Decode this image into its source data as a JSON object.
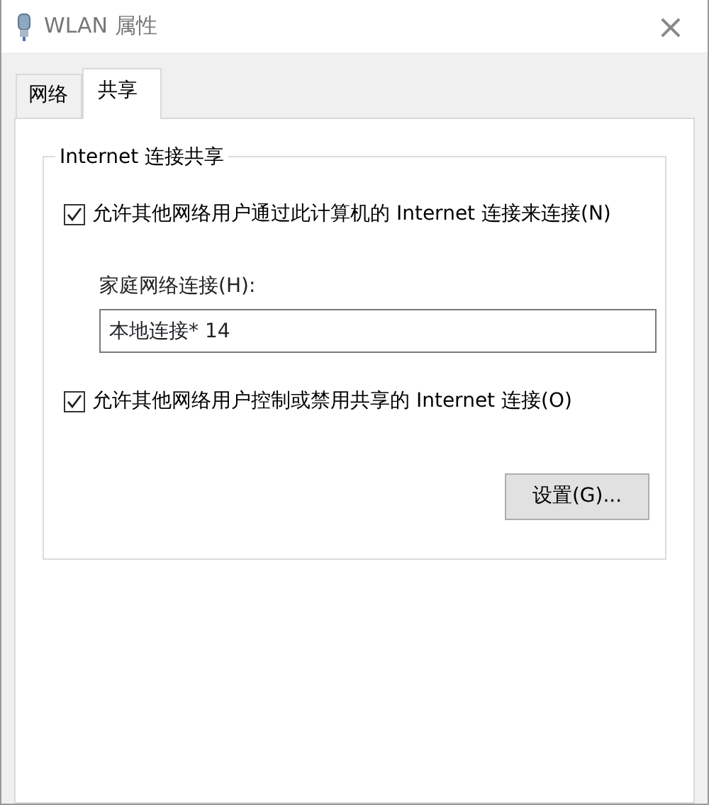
{
  "window": {
    "title": "WLAN 属性",
    "close": "×"
  },
  "tabs": [
    {
      "label": "网络",
      "selected": false
    },
    {
      "label": "共享",
      "selected": true
    }
  ],
  "group": {
    "title": "Internet 连接共享",
    "allow_sharing": {
      "label": "允许其他网络用户通过此计算机的 Internet 连接来连接(N)",
      "checked": true
    },
    "home_network": {
      "label": "家庭网络连接(H):",
      "value": "本地连接* 14"
    },
    "allow_control": {
      "label": "允许其他网络用户控制或禁用共享的 Internet 连接(O)",
      "checked": true
    },
    "settings_button": "设置(G)..."
  }
}
